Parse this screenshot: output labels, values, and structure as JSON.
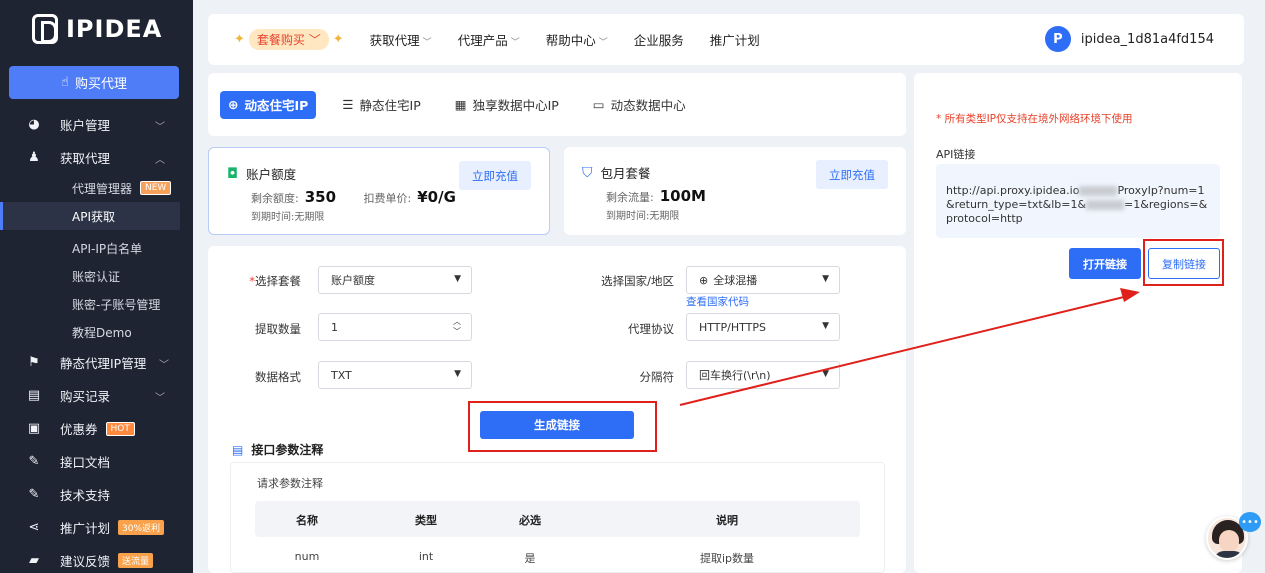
{
  "brand": {
    "name": "IPIDEA"
  },
  "sidebar": {
    "buy_button": "购买代理",
    "items": [
      {
        "label": "账户管理",
        "icon": "pie-chart-icon"
      },
      {
        "label": "获取代理",
        "icon": "user-icon"
      },
      {
        "label": "静态代理IP管理",
        "icon": "flag-icon"
      },
      {
        "label": "购买记录",
        "icon": "basket-icon"
      },
      {
        "label": "优惠券",
        "icon": "ticket-icon",
        "tag": "HOT"
      },
      {
        "label": "接口文档",
        "icon": "edit-icon"
      },
      {
        "label": "技术支持",
        "icon": "edit-icon"
      },
      {
        "label": "推广计划",
        "icon": "share-icon",
        "tag": "30%返利"
      },
      {
        "label": "建议反馈",
        "icon": "feedback-icon",
        "tag": "送流量"
      }
    ],
    "sub_items": [
      {
        "label": "代理管理器",
        "tag": "NEW"
      },
      {
        "label": "API获取"
      },
      {
        "label": "API-IP白名单"
      },
      {
        "label": "账密认证"
      },
      {
        "label": "账密-子账号管理"
      },
      {
        "label": "教程Demo"
      }
    ]
  },
  "topbar": {
    "package_buy": "套餐购买",
    "nav": [
      "获取代理",
      "代理产品",
      "帮助中心",
      "企业服务",
      "推广计划"
    ],
    "username": "ipidea_1d81a4fd154"
  },
  "tabs": [
    "动态住宅IP",
    "静态住宅IP",
    "独享数据中心IP",
    "动态数据中心"
  ],
  "account_quota": {
    "title": "账户额度",
    "remaining_label": "剩余额度:",
    "remaining_value": "350",
    "price_label": "扣费单价:",
    "price_value": "¥0/G",
    "expiry": "到期时间:无期限",
    "button": "立即充值"
  },
  "monthly_package": {
    "title": "包月套餐",
    "remaining_label": "剩余流量:",
    "remaining_value": "100M",
    "expiry": "到期时间:无期限",
    "button": "立即充值"
  },
  "form": {
    "package_label": "选择套餐",
    "package_value": "账户额度",
    "region_label": "选择国家/地区",
    "region_value": "全球混播",
    "region_link": "查看国家代码",
    "count_label": "提取数量",
    "count_value": "1",
    "protocol_label": "代理协议",
    "protocol_value": "HTTP/HTTPS",
    "format_label": "数据格式",
    "format_value": "TXT",
    "separator_label": "分隔符",
    "separator_value": "回车换行(\\r\\n)",
    "generate_button": "生成链接"
  },
  "params": {
    "section_title": "接口参数注释",
    "sub_title": "请求参数注释",
    "headers": [
      "名称",
      "类型",
      "必选",
      "说明"
    ],
    "rows": [
      [
        "num",
        "int",
        "是",
        "提取ip数量"
      ]
    ]
  },
  "api_panel": {
    "notice": "* 所有类型IP仅支持在境外网络环境下使用",
    "label": "API链接",
    "url_part1": "http://api.proxy.ipidea.io",
    "url_part2": "ProxyIp?num=1&return_type=txt&lb=1&",
    "url_part3": "=1&regions=&protocol=http",
    "open_button": "打开链接",
    "copy_button": "复制链接"
  },
  "colors": {
    "accent": "#2e6ef6",
    "sidebar": "#1f2433",
    "highlight": "#e0201b"
  }
}
